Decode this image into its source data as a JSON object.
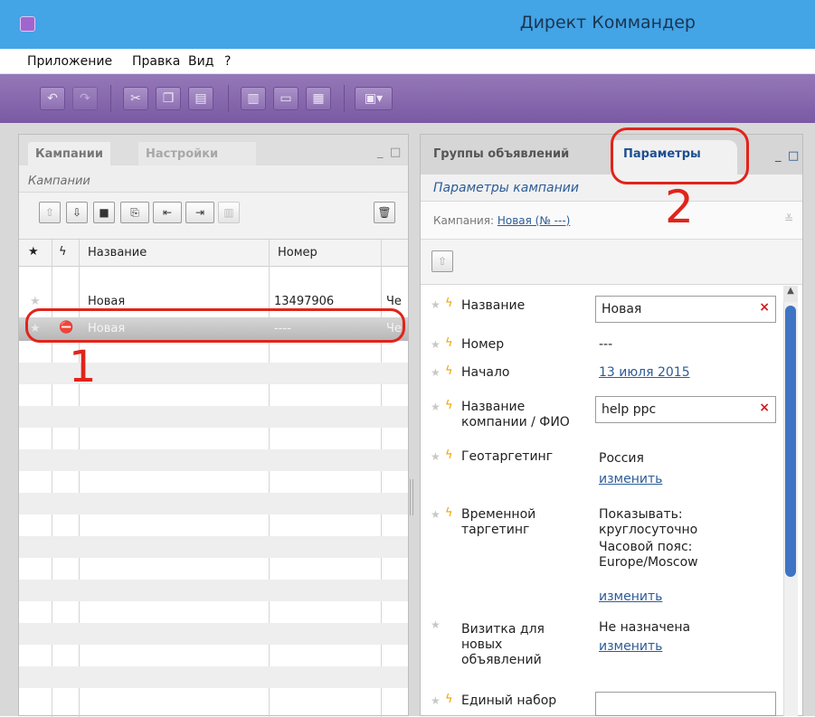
{
  "window": {
    "title": "Директ Коммандер"
  },
  "menu": [
    "Приложение",
    "Правка",
    "Вид",
    "?"
  ],
  "left_panel": {
    "tabs": [
      "Кампании",
      "Настройки"
    ],
    "subtitle": "Кампании",
    "columns": [
      "Название",
      "Номер"
    ],
    "rows": [
      {
        "name": "Новая",
        "number": "13497906",
        "extra": "Че"
      },
      {
        "name": "Новая",
        "number": "----",
        "extra": "Че"
      }
    ],
    "annotation": "1"
  },
  "right_panel": {
    "tabs": [
      "Группы объявлений",
      "Параметры"
    ],
    "subtitle": "Параметры кампании",
    "campaign_label": "Кампания:",
    "campaign_value": "Новая (№ ---)",
    "annotation": "2",
    "props": {
      "name_label": "Название",
      "name_value": "Новая",
      "number_label": "Номер",
      "number_value": "---",
      "start_label": "Начало",
      "start_value": "13 июля 2015",
      "company_label_1": "Название",
      "company_label_2": "компании / ФИО",
      "company_value": "help ppc",
      "geo_label": "Геотаргетинг",
      "geo_value": "Россия",
      "geo_link": "изменить",
      "time_label_1": "Временной",
      "time_label_2": "таргетинг",
      "time_value_1": "Показывать:",
      "time_value_2": "круглосуточно",
      "time_value_3": "Часовой пояс:",
      "time_value_4": "Europe/Moscow",
      "time_link": "изменить",
      "card_label_1": "Визитка для",
      "card_label_2": "новых",
      "card_label_3": "объявлений",
      "card_value": "Не назначена",
      "card_link": "изменить",
      "set_label": "Единый набор"
    }
  },
  "colors": {
    "title_bar": "#43a4e6",
    "toolbar": "#7a5aa3",
    "highlight": "#e2231a",
    "link": "#2d5c98"
  }
}
